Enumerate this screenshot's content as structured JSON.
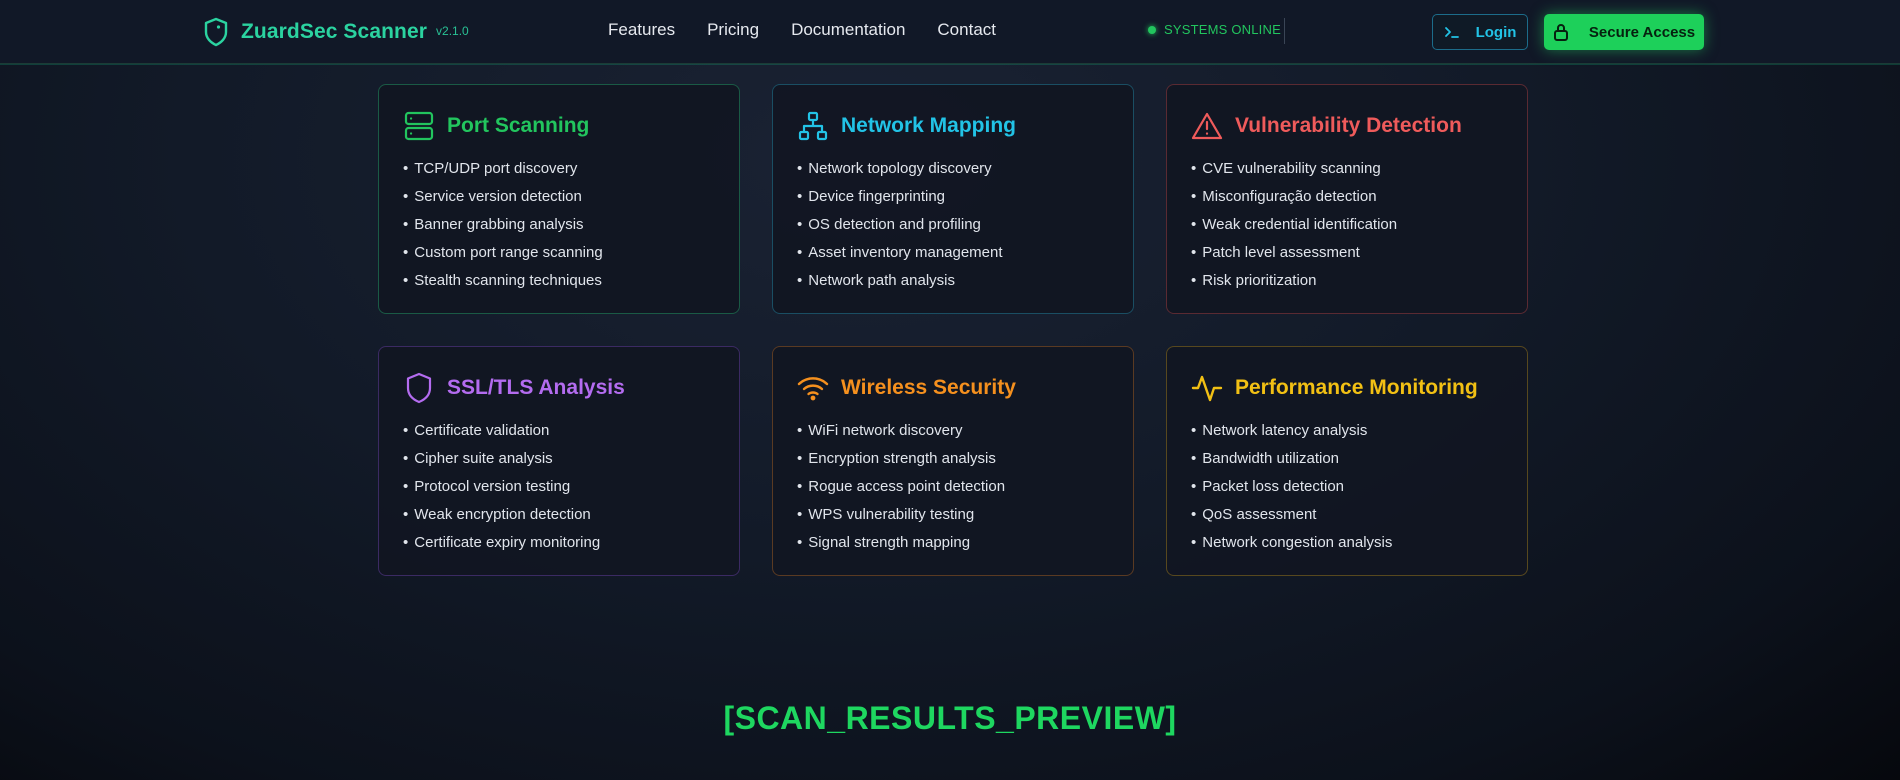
{
  "header": {
    "brand_name": "ZuardSec Scanner",
    "brand_version": "v2.1.0",
    "nav": [
      "Features",
      "Pricing",
      "Documentation",
      "Contact"
    ],
    "status_text": "SYSTEMS ONLINE",
    "login_label": "Login",
    "secure_label": "Secure Access"
  },
  "cards": [
    {
      "title": "Port Scanning",
      "color": "#22c55e",
      "icon": "server-icon",
      "items": [
        "TCP/UDP port discovery",
        "Service version detection",
        "Banner grabbing analysis",
        "Custom port range scanning",
        "Stealth scanning techniques"
      ]
    },
    {
      "title": "Network Mapping",
      "color": "#22c3e6",
      "icon": "network-icon",
      "items": [
        "Network topology discovery",
        "Device fingerprinting",
        "OS detection and profiling",
        "Asset inventory management",
        "Network path analysis"
      ]
    },
    {
      "title": "Vulnerability Detection",
      "color": "#ef5b5b",
      "icon": "warning-icon",
      "items": [
        "CVE vulnerability scanning",
        "Misconfiguração detection",
        "Weak credential identification",
        "Patch level assessment",
        "Risk prioritization"
      ]
    },
    {
      "title": "SSL/TLS Analysis",
      "color": "#b46cf0",
      "icon": "shield-icon",
      "items": [
        "Certificate validation",
        "Cipher suite analysis",
        "Protocol version testing",
        "Weak encryption detection",
        "Certificate expiry monitoring"
      ]
    },
    {
      "title": "Wireless Security",
      "color": "#f5901e",
      "icon": "wifi-icon",
      "items": [
        "WiFi network discovery",
        "Encryption strength analysis",
        "Rogue access point detection",
        "WPS vulnerability testing",
        "Signal strength mapping"
      ]
    },
    {
      "title": "Performance Monitoring",
      "color": "#f2c014",
      "icon": "activity-icon",
      "items": [
        "Network latency analysis",
        "Bandwidth utilization",
        "Packet loss detection",
        "QoS assessment",
        "Network congestion analysis"
      ]
    }
  ],
  "section_title": "[SCAN_RESULTS_PREVIEW]"
}
